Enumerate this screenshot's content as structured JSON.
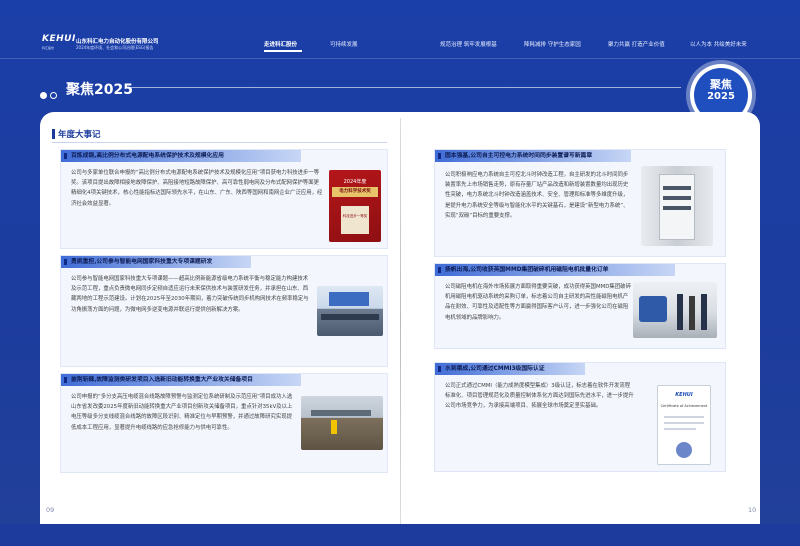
{
  "header": {
    "logo_text": "KEHUI",
    "logo_sub": "科汇股份",
    "company": "山东科汇电力自动化股份有限公司",
    "report": "2024年度环境、社会和公司治理(ESG)报告",
    "nav": [
      "走进科汇股份",
      "可持续发展",
      "规范治理 筑牢发展根基",
      "降耗减排 守护生态家园",
      "聚力共赢 打造产业价值",
      "以人为本 共绘美好未来"
    ]
  },
  "section": {
    "title": "聚焦2025",
    "badge_line1": "聚焦",
    "badge_line2": "2025"
  },
  "left": {
    "column_title": "年度大事记",
    "page_number": "09",
    "cards": [
      {
        "title": "百炼成钢,高比例分布式电源配电系统保护技术及规模化应用",
        "body": "公司与多家单位联合申报的“高比例分布式电源配电系统保护技术及规模化应用”项目获电力科技进步一等奖。该项目提出故障相接地故障保护、高阻接地短路故障保护、高可靠性弱电网及分布式配网保护等面更精细化4项关键技术，核心性能指标达国际领先水平，在山东、广东、陕西等国网和南网企业广泛应用，经济社会效益显著。"
      },
      {
        "title": "勇挑重担,公司参与智能电网国家科技重大专项课题研发",
        "body": "公司参与智能电网国家科技重大专项课题——超高比例新能源省级电力系统平衡与稳定能力构建技术及示范工程，重点负责微电网同步定频自适应运行未来保供技术与装置研发任务，并承担在山东、西藏两地的工程示范建设。计划在2025年至2030年期间，着力突破传统同步机构网技术在频率稳定与功角振荡方面的问题，为微电网多逆变电源并联运行提供创新解决方案。"
      },
      {
        "title": "披荆斩棘,故障监测类研发项目入选新旧动能转换重大产业攻关储备项目",
        "body": "公司申报的“多分支高压电缆混合线路故障预警与监测定位系统研制及示范应用”项目成功入选山东省发改委2025年度新旧动能转换重大产业项目创新攻关储备项目，重点针对35kV及以上电压等级多分支线缆混合线路的故障区段识别、精准定位与早期预警，并通过故障研究实现提低成本工程应用，显著提升电缆线路的应急抢修能力与供电可靠性。"
      }
    ],
    "certificate": {
      "line1": "2024年度",
      "line2": "电力科学技术奖",
      "line3": "科技进步一等奖"
    }
  },
  "right": {
    "page_number": "10",
    "cards": [
      {
        "title": "固本强基,公司自主可控电力系统时间同步装置谱写新篇章",
        "body": "公司积极响应电力系统自主可控北斗时钟改造工程，自主研发的北斗时间同步装置率先上市场销售走势，原有存量厂站产品改造和新增装置数量均出现历史性突破，电力系统北斗时钟改造涵盖技术、安全、管理和标准等多维度升级，是提升电力系统安全等级与智能化水平的关键基石，是建设“新型电力系统”、实现“双碳”目标的重要支撑。"
      },
      {
        "title": "扬帆出海,公司收获英国MMD集团破碎机用磁阻电机批量化订单",
        "body": "公司磁阻电机在海外市场拓展方面取得重要突破，成功获得英国MMD集团破碎机用磁阻电机驱动系统的采购订单，标志着公司自主研发的高性能磁阻电机产品在耐效、可靠性及适配性等方面赢得国际客户认可，进一步强化公司在磁阻电机领域的品牌影响力。"
      },
      {
        "title": "水到渠成,公司通过CMMI3级国际认证",
        "body": "公司正式通过CMMI（能力成熟度模型集成）3级认证，标志着在软件开发流程标准化、项目管理规范化及质量控制体系化方面达到国际先进水平，进一步提升公司市场竞争力，为承接高端项目、拓展全球市场奠定坚实基础。"
      }
    ],
    "cmmi_cert": {
      "brand": "KEHUI",
      "title": "Certificate of Achievement"
    }
  }
}
